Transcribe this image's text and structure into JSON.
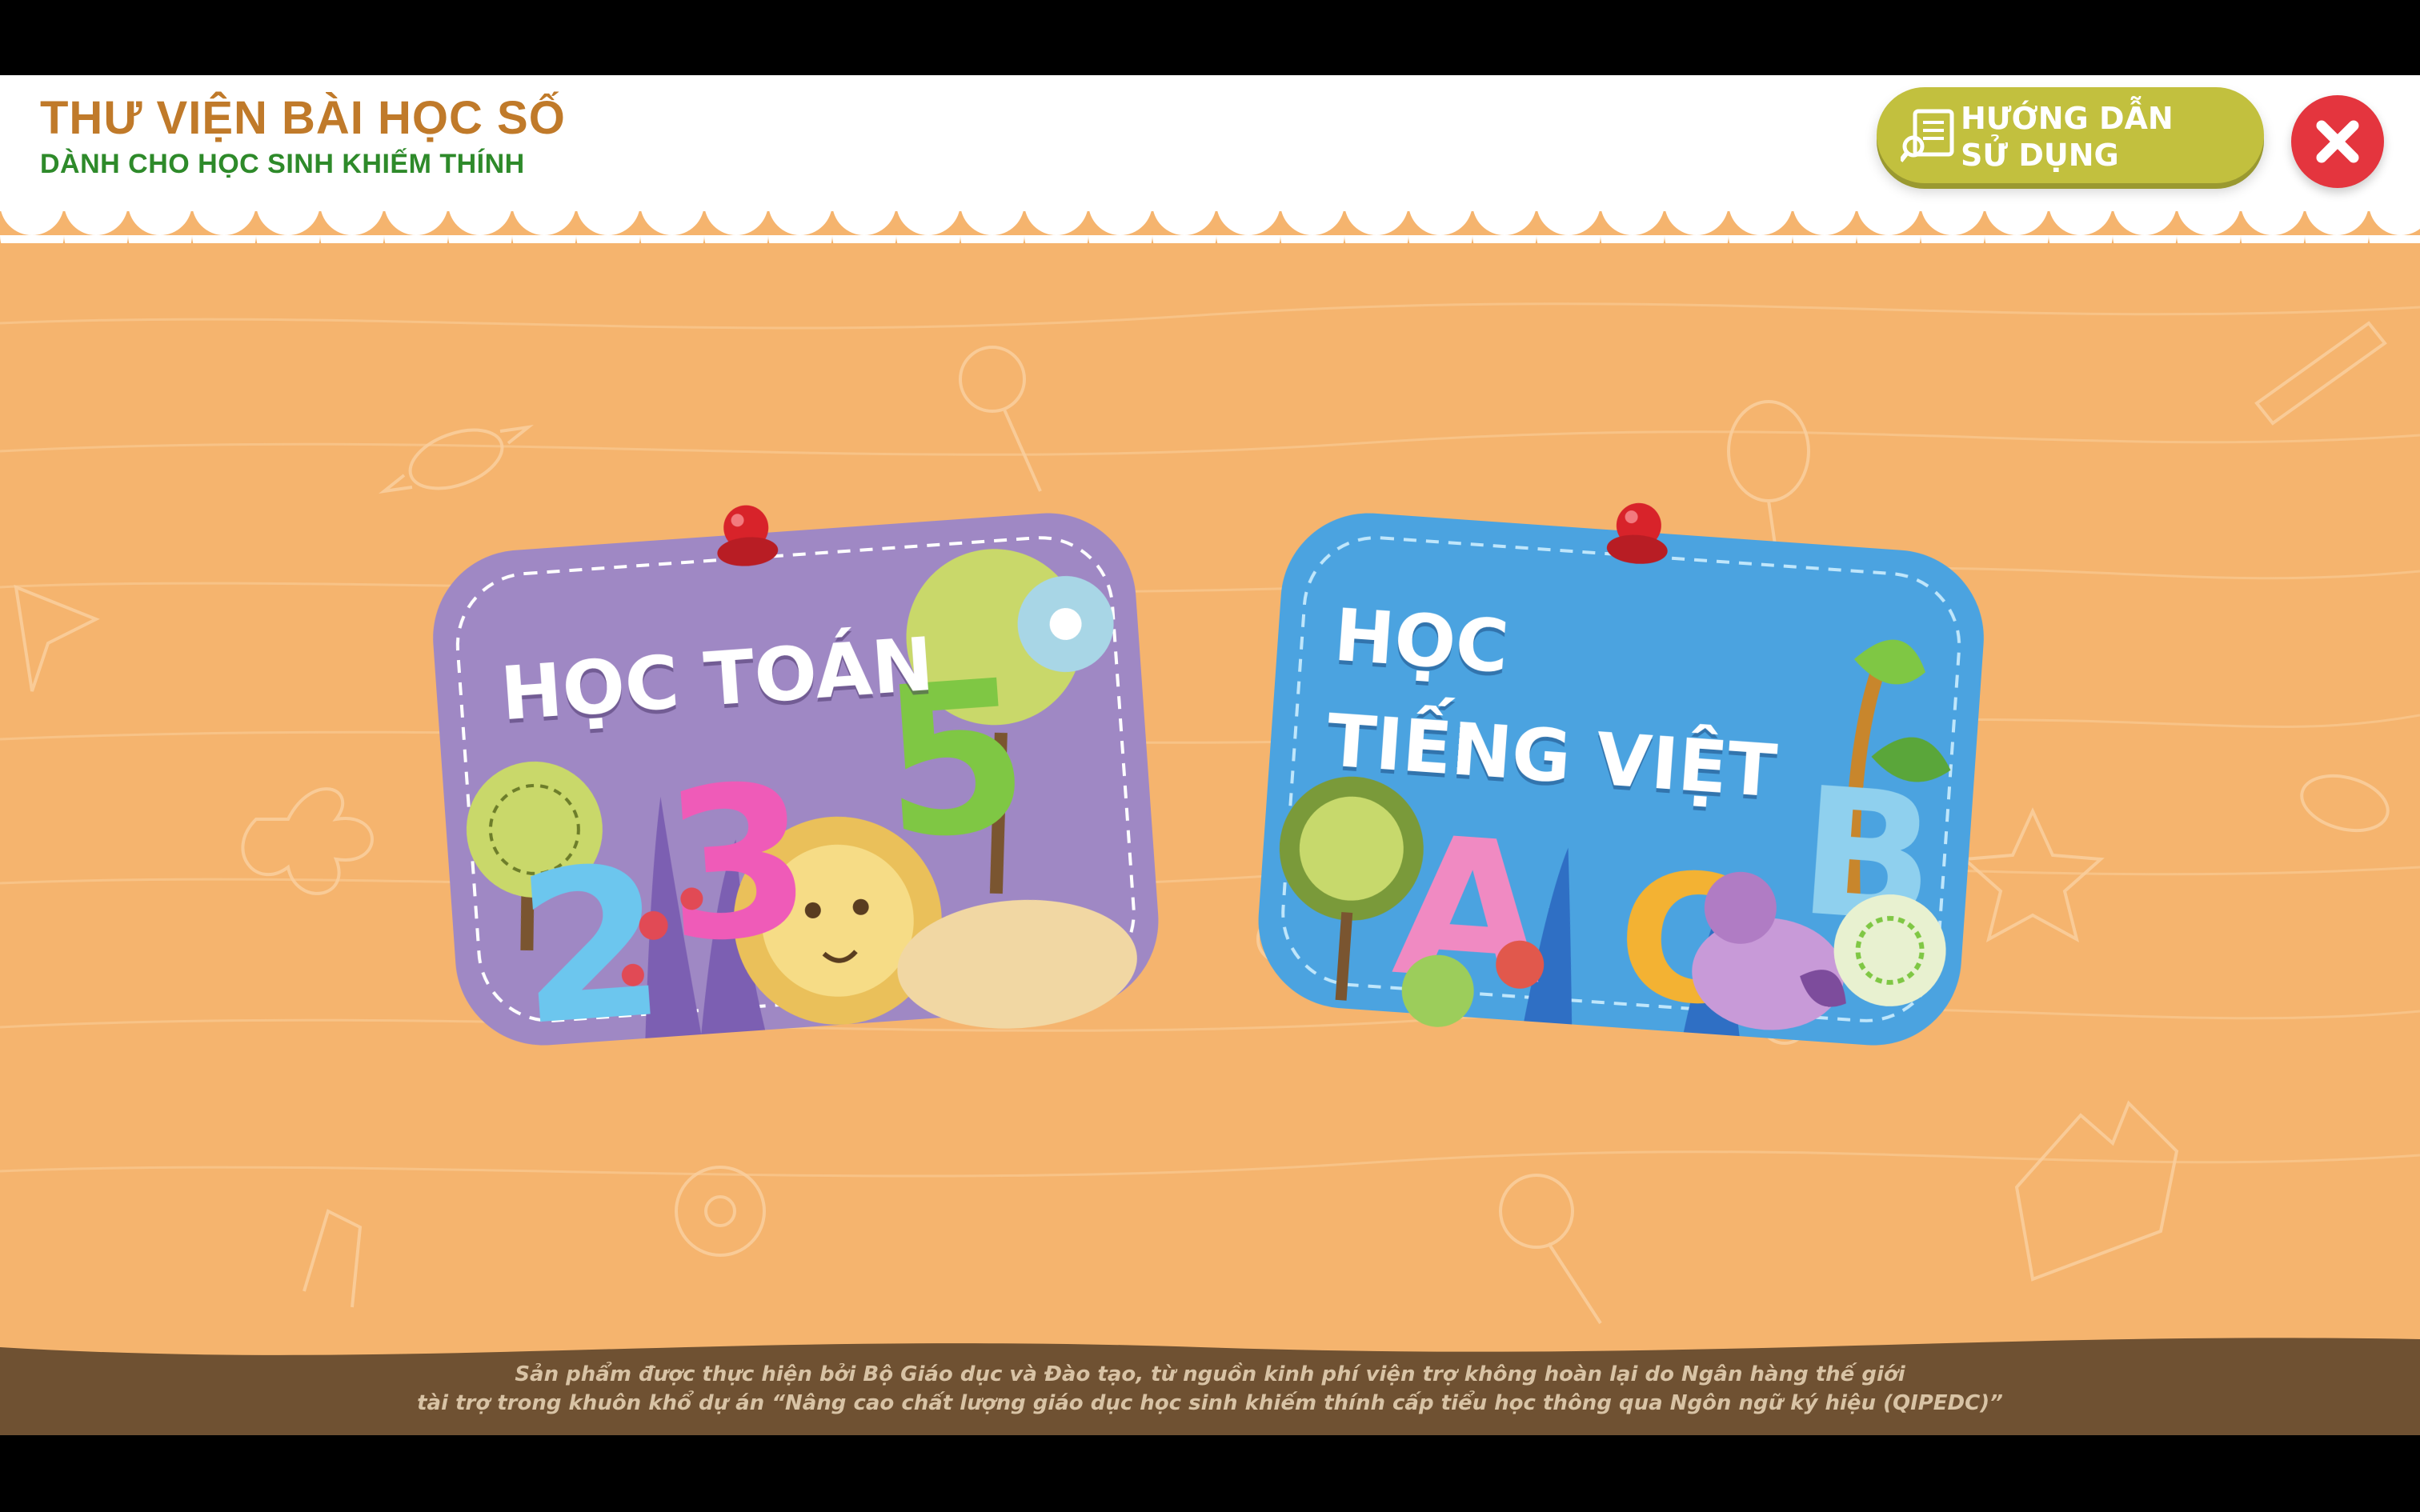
{
  "header": {
    "title": "THƯ VIỆN BÀI HỌC SỐ",
    "subtitle": "DÀNH CHO HỌC SINH KHIẾM THÍNH",
    "guide_button": {
      "label": "HƯỚNG DẪN\nSỬ DỤNG",
      "icon": "manual-icon"
    },
    "close_button": {
      "icon": "close-icon"
    }
  },
  "cards": [
    {
      "label": "HỌC TOÁN",
      "color": "#9f88c4",
      "art": "numbers 2 3 5 with lion and trees"
    },
    {
      "label": "HỌC\nTIẾNG VIỆT",
      "color": "#4ba3e0",
      "art": "letters A B C with bird and plants"
    }
  ],
  "footer": {
    "line1": "Sản phẩm được thực hiện bởi Bộ Giáo dục và Đào tạo, từ nguồn kinh phí viện trợ không hoàn lại do Ngân hàng thế giới",
    "line2": "tài trợ trong khuôn khổ dự án “Nâng cao chất lượng giáo dục học sinh khiếm thính cấp tiểu học thông qua Ngôn ngữ ký hiệu (QIPEDC)”"
  },
  "colors": {
    "background": "#f5b46e",
    "title": "#c07a2a",
    "subtitle": "#2e8a2a",
    "guide_button": "#c2c03e",
    "close_button": "#e4353e",
    "footer": "#6f5132"
  }
}
